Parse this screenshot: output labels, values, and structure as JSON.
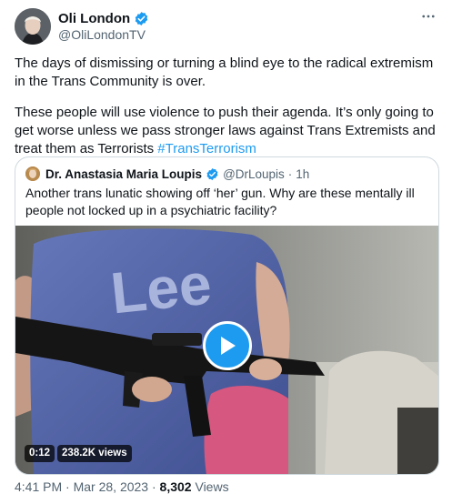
{
  "author": {
    "name": "Oli London",
    "handle": "@OliLondonTV"
  },
  "tweet": {
    "paragraph1": "The days of dismissing or turning a blind eye to the radical extremism in the Trans Community is over.",
    "paragraph2": "These people will use violence to push their agenda. It’s only going to get worse unless we pass stronger laws against Trans Extremists and treat them as Terrorists ",
    "hashtag": "#TransTerrorism"
  },
  "quoted": {
    "name": "Dr. Anastasia Maria Loupis",
    "handle": "@DrLoupis",
    "separator": "·",
    "time": "1h",
    "text": "Another trans lunatic showing off ‘her’ gun. Why are these mentally ill people not locked up in a psychiatric facility?",
    "video": {
      "duration": "0:12",
      "views": "238.2K views",
      "shirt_text": "Lee"
    }
  },
  "footer": {
    "time": "4:41 PM",
    "separator": "·",
    "date": "Mar 28, 2023",
    "views_count": "8,302",
    "views_label": "Views"
  },
  "colors": {
    "accent": "#1d9bf0",
    "secondary_text": "#536471",
    "border": "#cfd9de"
  },
  "icons": {
    "verified": "verified-badge-icon",
    "more": "more-horizontal-icon",
    "play": "play-icon"
  }
}
